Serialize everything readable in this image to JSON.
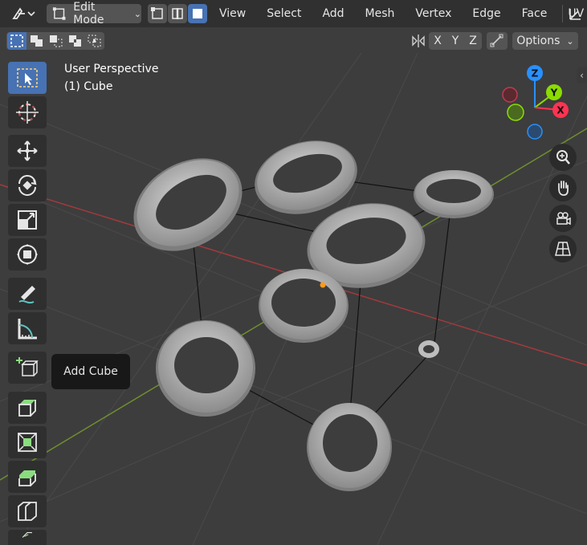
{
  "header": {
    "mode": "Edit Mode",
    "menus": [
      "View",
      "Select",
      "Add",
      "Mesh",
      "Vertex",
      "Edge",
      "Face",
      "UV"
    ]
  },
  "options": {
    "axes": [
      "X",
      "Y",
      "Z"
    ],
    "options_label": "Options"
  },
  "overlay": {
    "title": "User Perspective",
    "object": "(1) Cube"
  },
  "gizmo": {
    "axes": [
      "Z",
      "Y",
      "X"
    ],
    "colors": {
      "x": "#ff3352",
      "y": "#8bdc00",
      "z": "#2890ff"
    }
  },
  "tooltip": {
    "text": "Add Cube"
  },
  "toolbar": [
    {
      "name": "select-box",
      "active": true
    },
    {
      "name": "cursor",
      "active": false
    },
    {
      "name": "move",
      "active": false
    },
    {
      "name": "rotate",
      "active": false
    },
    {
      "name": "scale",
      "active": false
    },
    {
      "name": "transform",
      "active": false
    },
    {
      "name": "annotate",
      "active": false
    },
    {
      "name": "measure",
      "active": false
    },
    {
      "name": "add-cube",
      "active": false
    },
    {
      "name": "extrude",
      "active": false
    },
    {
      "name": "inset",
      "active": false
    },
    {
      "name": "bevel",
      "active": false
    },
    {
      "name": "loop-cut",
      "active": false
    }
  ],
  "colors": {
    "header_bg": "#303030",
    "viewport_bg": "#3d3d3d",
    "active_tool": "#4772b3",
    "x_axis_line": "#a23a3d",
    "y_axis_line": "#6e8f2f"
  }
}
